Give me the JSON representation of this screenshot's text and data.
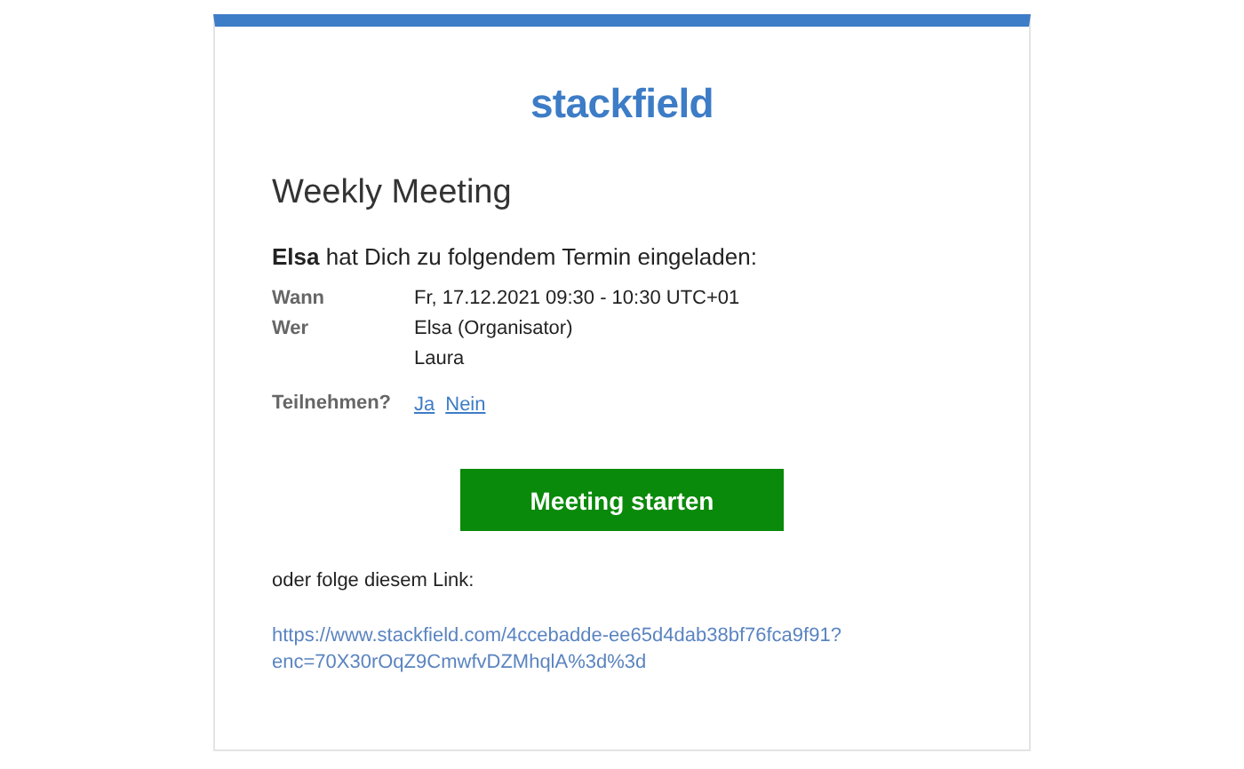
{
  "logo": "stackfield",
  "title": "Weekly Meeting",
  "invitation": "**Elsa** hat Dich zu folgendem Termin eingeladen:",
  "details": [
    {
      "label": "Wann",
      "values": [
        "Fr, 17.12.2021 09:30 - 10:30 UTC+01"
      ]
    },
    {
      "label": "Wer",
      "values": [
        "Elsa (Organisator)",
        "Laura"
      ]
    }
  ],
  "rsvp": {
    "label": "Teilnehmen?",
    "links": [
      "Ja",
      "Nein"
    ]
  },
  "button": "Meeting starten",
  "link_intro": "oder folge diesem Link:",
  "link_lines": [
    "https://www.stackfield.com/4ccebadde-ee65d4dab38bf76fca9f91?",
    "enc=70X30rOqZ9CmwfvDZMhqlA%3d%3d"
  ]
}
